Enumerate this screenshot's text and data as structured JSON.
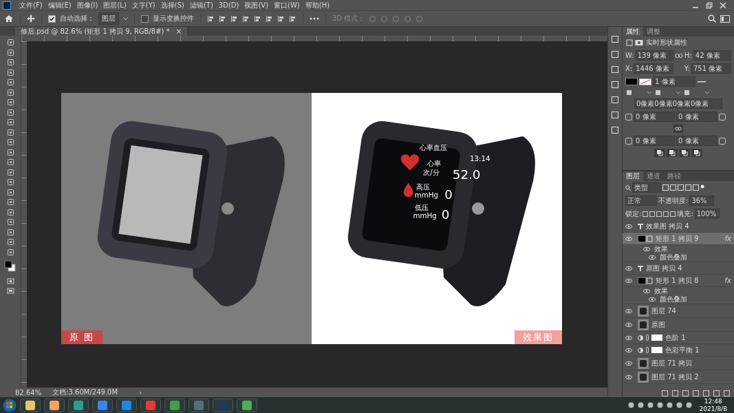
{
  "menu": [
    "文件(F)",
    "编辑(E)",
    "图像(I)",
    "图层(L)",
    "文字(Y)",
    "选择(S)",
    "滤镜(T)",
    "3D(D)",
    "视图(V)",
    "窗口(W)",
    "帮助(H)"
  ],
  "options": {
    "auto_select": {
      "label": "自动选择：",
      "checked": true
    },
    "auto_select_target": "图层",
    "show_transform": {
      "label": "显示变换控件",
      "checked": false
    },
    "mode_label": "3D 模式："
  },
  "doc_tab": {
    "title": "修后.psd @ 82.6% (矩形 1 拷贝 9, RGB/8#) *",
    "close": "×"
  },
  "canvas": {
    "left_label": "原 图",
    "right_label": "效果图",
    "screen": {
      "title": "心率血压",
      "rate_label": "心率",
      "rate_unit": "次/分",
      "time": "13:14",
      "rate": "52.0",
      "high_label": "高压",
      "high_unit": "mmHg",
      "high": "0",
      "low_label": "低压",
      "low_unit": "mmHg",
      "low": "0"
    }
  },
  "properties": {
    "tabs": [
      {
        "label": "属性",
        "selected": true
      },
      {
        "label": "调整",
        "selected": false
      }
    ],
    "title": "实时形状属性",
    "w_label": "W:",
    "w": "139 像素",
    "h_label": "H:",
    "h": "42 像素",
    "x_label": "X:",
    "x": "1446 像素",
    "y_label": "Y:",
    "y": "751 像素",
    "stroke_width": "1 像素",
    "corners_all": "0像素0像素0像素0像素",
    "corners": [
      "0 像素",
      "0 像素",
      "0 像素",
      "0 像素"
    ]
  },
  "layers": {
    "tabs": [
      {
        "label": "图层",
        "selected": true
      },
      {
        "label": "通道",
        "selected": false
      },
      {
        "label": "路径",
        "selected": false
      }
    ],
    "filter": "类型",
    "blend": "正常",
    "opacity_label": "不透明度:",
    "opacity": "36%",
    "lock_label": "锁定:",
    "fill_label": "填充:",
    "fill": "100%",
    "items": [
      {
        "kind": "text",
        "name": "效果图 拷贝 4",
        "selected": false
      },
      {
        "kind": "shape",
        "name": "矩形 1 拷贝 9",
        "selected": true,
        "fx": "fx",
        "effects_label": "效果",
        "effects": [
          "颜色叠加"
        ]
      },
      {
        "kind": "text",
        "name": "原图 拷贝 4",
        "selected": false
      },
      {
        "kind": "shape",
        "name": "矩形 1 拷贝 8",
        "selected": false,
        "fx": "fx",
        "effects_label": "效果",
        "effects": [
          "颜色叠加"
        ]
      },
      {
        "kind": "image",
        "name": "图层 74",
        "selected": false
      },
      {
        "kind": "image",
        "name": "原图",
        "selected": false
      },
      {
        "kind": "adjustment",
        "name": "色阶 1",
        "selected": false
      },
      {
        "kind": "adjustment",
        "name": "色彩平衡 1",
        "selected": false
      },
      {
        "kind": "image",
        "name": "图层 71 拷贝",
        "selected": false
      },
      {
        "kind": "image",
        "name": "图层 71 拷贝 2",
        "selected": false
      }
    ]
  },
  "status": {
    "zoom": "82.64%",
    "doc": "文档:3.60M/249.0M",
    "arrow": "›"
  },
  "taskbar": {
    "time": "12:48",
    "date": "2021/8/8"
  }
}
